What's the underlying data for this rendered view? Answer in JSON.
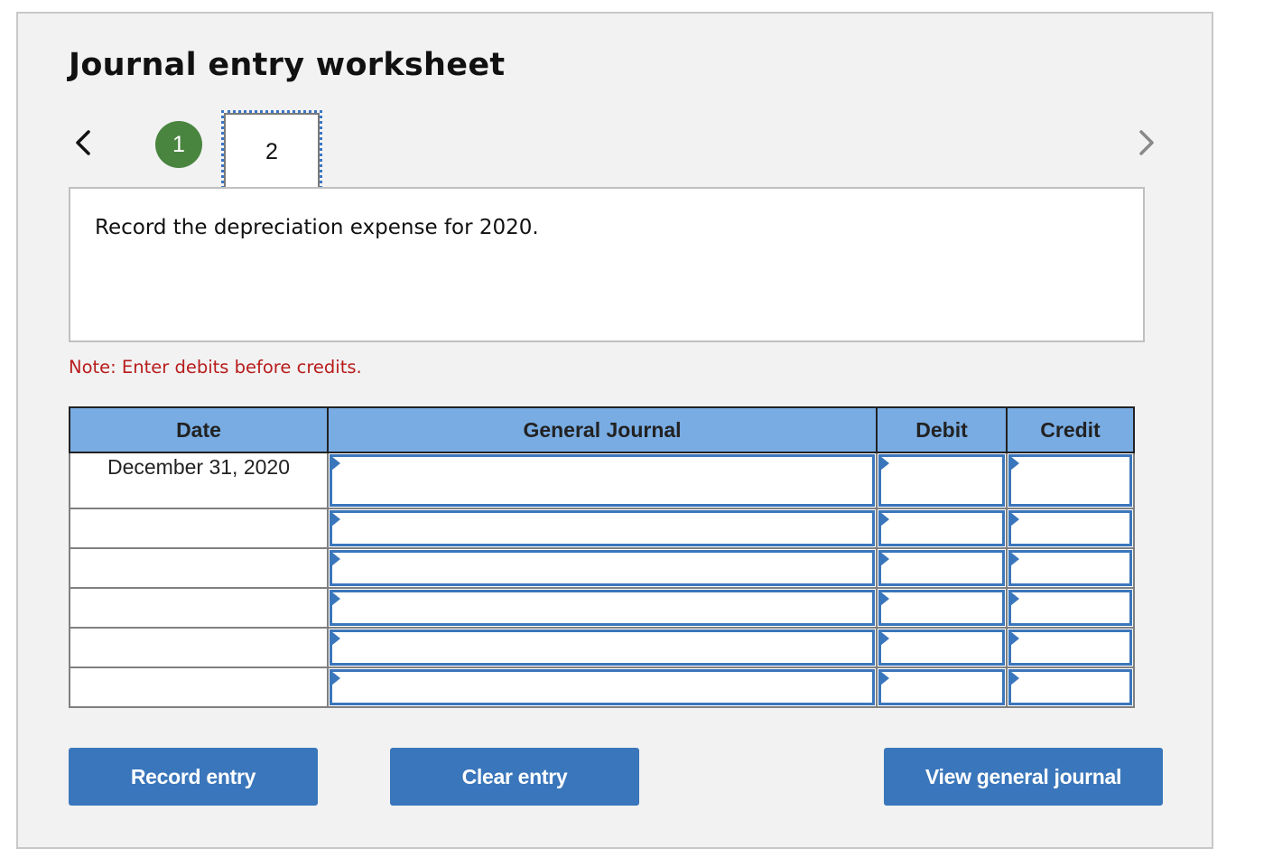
{
  "header": {
    "title": "Journal entry worksheet"
  },
  "navigation": {
    "prev_icon": "chevron-left-icon",
    "next_icon": "chevron-right-icon",
    "steps": [
      {
        "label": "1",
        "state": "completed",
        "color": "#4a8540"
      },
      {
        "label": "2",
        "state": "current"
      }
    ]
  },
  "question": {
    "text": "Record the depreciation expense for 2020."
  },
  "note": {
    "text": "Note: Enter debits before credits.",
    "color": "#b81c1c"
  },
  "journal_table": {
    "headers": {
      "date": "Date",
      "general_journal": "General Journal",
      "debit": "Debit",
      "credit": "Credit"
    },
    "header_color": "#78ace3",
    "rows": [
      {
        "date": "December 31, 2020",
        "account": "",
        "debit": "",
        "credit": ""
      },
      {
        "date": "",
        "account": "",
        "debit": "",
        "credit": ""
      },
      {
        "date": "",
        "account": "",
        "debit": "",
        "credit": ""
      },
      {
        "date": "",
        "account": "",
        "debit": "",
        "credit": ""
      },
      {
        "date": "",
        "account": "",
        "debit": "",
        "credit": ""
      },
      {
        "date": "",
        "account": "",
        "debit": "",
        "credit": ""
      }
    ]
  },
  "buttons": {
    "record_entry": "Record entry",
    "clear_entry": "Clear entry",
    "view_general_journal": "View general journal",
    "color": "#3a76bb"
  }
}
